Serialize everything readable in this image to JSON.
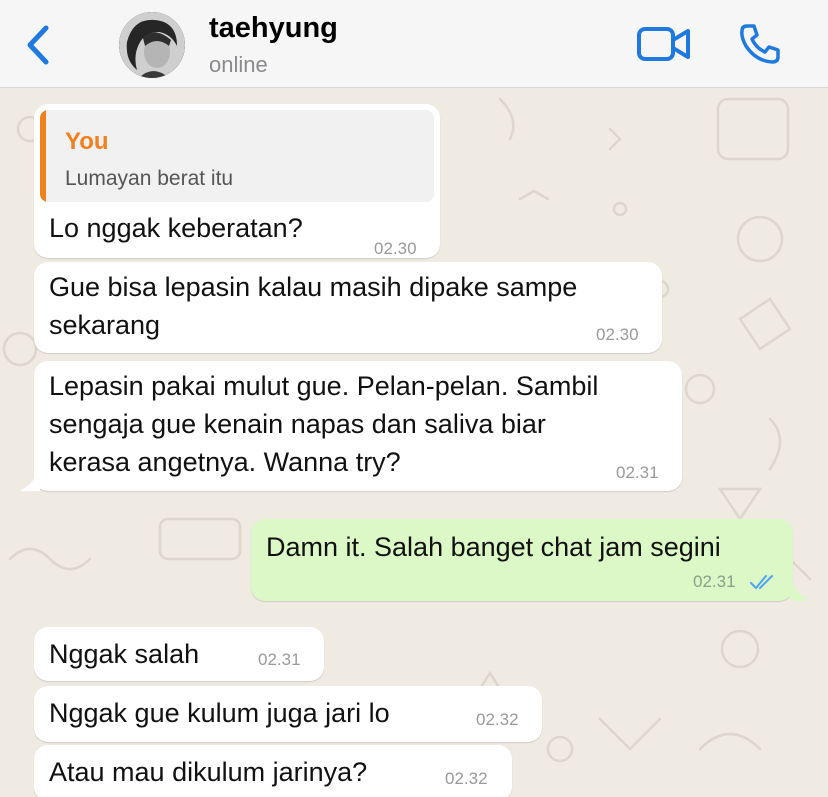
{
  "header": {
    "contact_name": "taehyung",
    "status": "online",
    "icons": {
      "back": "chevron-left-icon",
      "video": "video-camera-icon",
      "call": "phone-icon"
    },
    "accent_color": "#1f7ae0"
  },
  "messages": [
    {
      "direction": "incoming",
      "reply_to": {
        "author": "You",
        "text": "Lumayan berat itu"
      },
      "text": "Lo nggak keberatan?",
      "time": "02.30"
    },
    {
      "direction": "incoming",
      "text": "Gue bisa lepasin kalau masih dipake sampe\nsekarang",
      "time": "02.30"
    },
    {
      "direction": "incoming",
      "text": "Lepasin pakai mulut gue. Pelan-pelan. Sambil\nsengaja gue kenain napas dan saliva biar\nkerasa angetnya. Wanna try?",
      "time": "02.31"
    },
    {
      "direction": "outgoing",
      "text": "Damn it. Salah banget chat jam segini",
      "time": "02.31",
      "read_status": "read"
    },
    {
      "direction": "incoming",
      "text": "Nggak salah",
      "time": "02.31"
    },
    {
      "direction": "incoming",
      "text": "Nggak gue kulum juga jari lo",
      "time": "02.32"
    },
    {
      "direction": "incoming",
      "text": "Atau mau dikulum jarinya?",
      "time": "02.32"
    }
  ],
  "colors": {
    "incoming_bubble": "#ffffff",
    "outgoing_bubble": "#dcf8c6",
    "reply_accent": "#f0811e",
    "read_ticks": "#4fa3f0",
    "wallpaper": "#efeae2"
  }
}
